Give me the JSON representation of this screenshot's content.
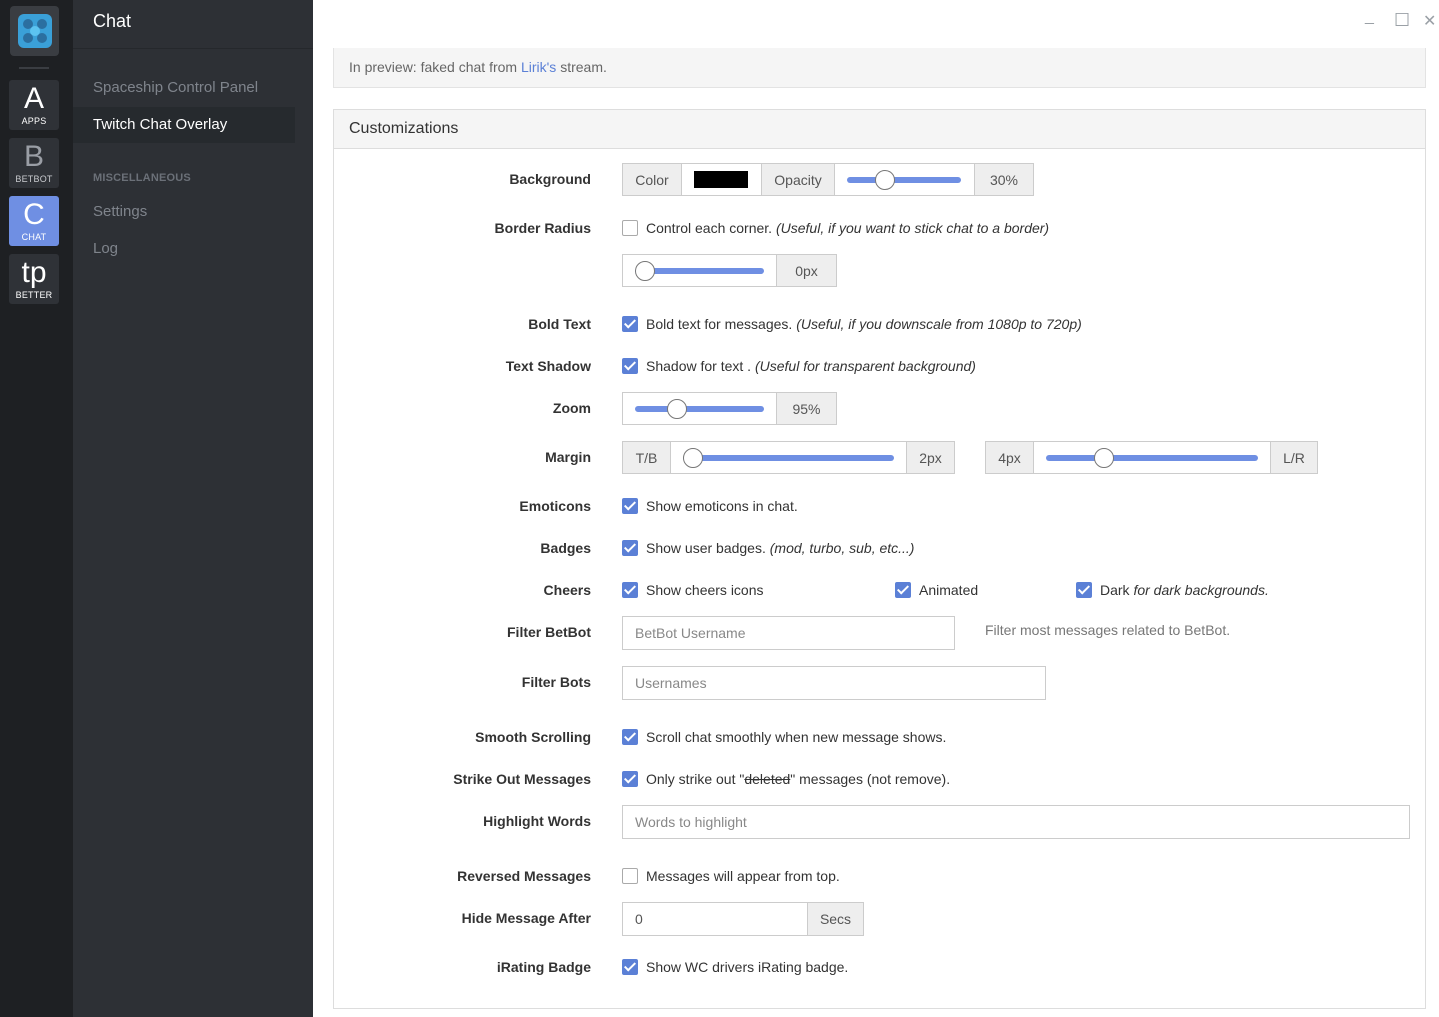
{
  "app": {
    "rail": [
      {
        "big": "A",
        "small": "APPS"
      },
      {
        "big": "B",
        "small": "BETBOT"
      },
      {
        "big": "C",
        "small": "CHAT"
      },
      {
        "big": "tp",
        "small": "BETTER"
      }
    ]
  },
  "nav": {
    "title": "Chat",
    "items": [
      "Spaceship Control Panel",
      "Twitch Chat Overlay"
    ],
    "section": "MISCELLANEOUS",
    "misc": [
      "Settings",
      "Log"
    ]
  },
  "window": {
    "minimize": "_",
    "maximize": "☐",
    "close": "✕"
  },
  "preview": {
    "prefix": "In preview: faked chat from ",
    "link": "Lirik's",
    "suffix": " stream."
  },
  "panel": {
    "title": "Customizations"
  },
  "fields": {
    "background": {
      "label": "Background",
      "color_label": "Color",
      "color": "#000000",
      "opacity_label": "Opacity",
      "opacity_value": "30%",
      "opacity_level": 0.3
    },
    "border_radius": {
      "label": "Border Radius",
      "checkbox_text": "Control each corner.",
      "hint": "(Useful, if you want to stick chat to a border)",
      "checked": false,
      "value": "0px"
    },
    "bold_text": {
      "label": "Bold Text",
      "text": "Bold text for messages.",
      "hint": "(Useful, if you downscale from 1080p to 720p)",
      "checked": true
    },
    "text_shadow": {
      "label": "Text Shadow",
      "text": "Shadow for text .",
      "hint": "(Useful for transparent background)",
      "checked": true
    },
    "zoom": {
      "label": "Zoom",
      "value": "95%"
    },
    "margin": {
      "label": "Margin",
      "tb_label": "T/B",
      "tb_value": "2px",
      "lr_value": "4px",
      "lr_label": "L/R"
    },
    "emoticons": {
      "label": "Emoticons",
      "text": "Show emoticons in chat.",
      "checked": true
    },
    "badges": {
      "label": "Badges",
      "text": "Show user badges.",
      "hint": "(mod, turbo, sub, etc...)",
      "checked": true
    },
    "cheers": {
      "label": "Cheers",
      "text": "Show cheers icons",
      "animated": "Animated",
      "dark": "Dark",
      "dark_hint": "for dark backgrounds."
    },
    "filter_betbot": {
      "label": "Filter BetBot",
      "placeholder": "BetBot Username",
      "hint": "Filter most messages related to BetBot."
    },
    "filter_bots": {
      "label": "Filter Bots",
      "placeholder": "Usernames"
    },
    "smooth_scrolling": {
      "label": "Smooth Scrolling",
      "text": "Scroll chat smoothly when new message shows.",
      "checked": true
    },
    "strike_out": {
      "label": "Strike Out Messages",
      "text_a": "Only strike out \"",
      "text_strike": "deleted",
      "text_b": "\" messages (not remove).",
      "checked": true
    },
    "highlight_words": {
      "label": "Highlight Words",
      "placeholder": "Words to highlight"
    },
    "reversed": {
      "label": "Reversed Messages",
      "text": "Messages will appear from top.",
      "checked": false
    },
    "hide_after": {
      "label": "Hide Message After",
      "value": "0",
      "unit": "Secs"
    },
    "irating": {
      "label": "iRating Badge",
      "text": "Show WC drivers iRating badge.",
      "checked": true
    }
  }
}
